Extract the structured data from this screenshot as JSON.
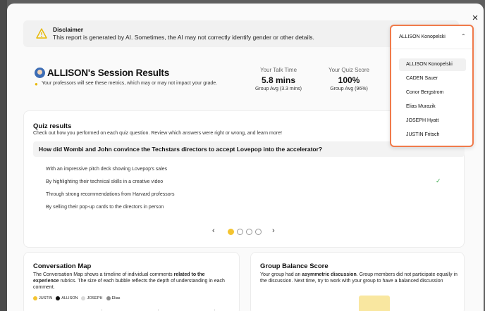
{
  "disclaimer": {
    "title": "Disclaimer",
    "text": "This report is generated by AI. Sometimes, the AI may not correctly identify gender or other details."
  },
  "session": {
    "title": "ALLISON's Session Results",
    "note": "Your professors will see these metrics, which may or may not impact your grade."
  },
  "metrics": [
    {
      "label": "Your Talk Time",
      "value": "5.8 mins",
      "group": "Group Avg (3.3 mins)"
    },
    {
      "label": "Your Quiz Score",
      "value": "100%",
      "group": "Group Avg (96%)"
    }
  ],
  "quiz": {
    "title": "Quiz results",
    "subtitle": "Check out how you performed on each quiz question. Review which answers were right or wrong, and learn more!",
    "question": "How did Wombi and John convince the Techstars directors to accept Lovepop into the accelerator?",
    "answers": [
      "With an impressive pitch deck showing Lovepop's sales",
      "By highlighting their technical skills in a creative video",
      "Through strong recommendations from Harvard professors",
      "By selling their pop-up cards to the directors in person"
    ],
    "correct_index": 1,
    "current_page": 1,
    "total_pages": 4
  },
  "conversation_map": {
    "title": "Conversation Map",
    "text_a": "The Conversation Map shows a timeline of individual comments ",
    "text_bold": "related to the experience",
    "text_b": " rubrics. The size of each bubble reflects the depth of understanding in each comment.",
    "legend": [
      {
        "name": "JUSTIN",
        "color": "#f4c430"
      },
      {
        "name": "ALLISON",
        "color": "#111111"
      },
      {
        "name": "JOSEPH",
        "color": "#d9d9d9"
      },
      {
        "name": "Elias",
        "color": "#8c8c8c"
      }
    ]
  },
  "group_balance": {
    "title": "Group Balance Score",
    "text_a": "Your group had an ",
    "text_bold": "asymmetric discussion",
    "text_b": ". Group members did not participate equally in the discussion. Next time, try to work with your group to have a balanced discussion"
  },
  "dropdown": {
    "selected": "ALLISON Konopelski",
    "options": [
      "ALLISON Konopelski",
      "CADEN Sauer",
      "Conor Bergstrom",
      "Elias Murazik",
      "JOSEPH Hyatt",
      "JUSTIN Fritsch"
    ],
    "highlighted_index": 0,
    "accent": "#f07a4a"
  },
  "icons": {
    "close": "×",
    "check": "✓",
    "chevron_up": "⌃",
    "prev": "‹",
    "next": "›",
    "bulb": "💡"
  }
}
